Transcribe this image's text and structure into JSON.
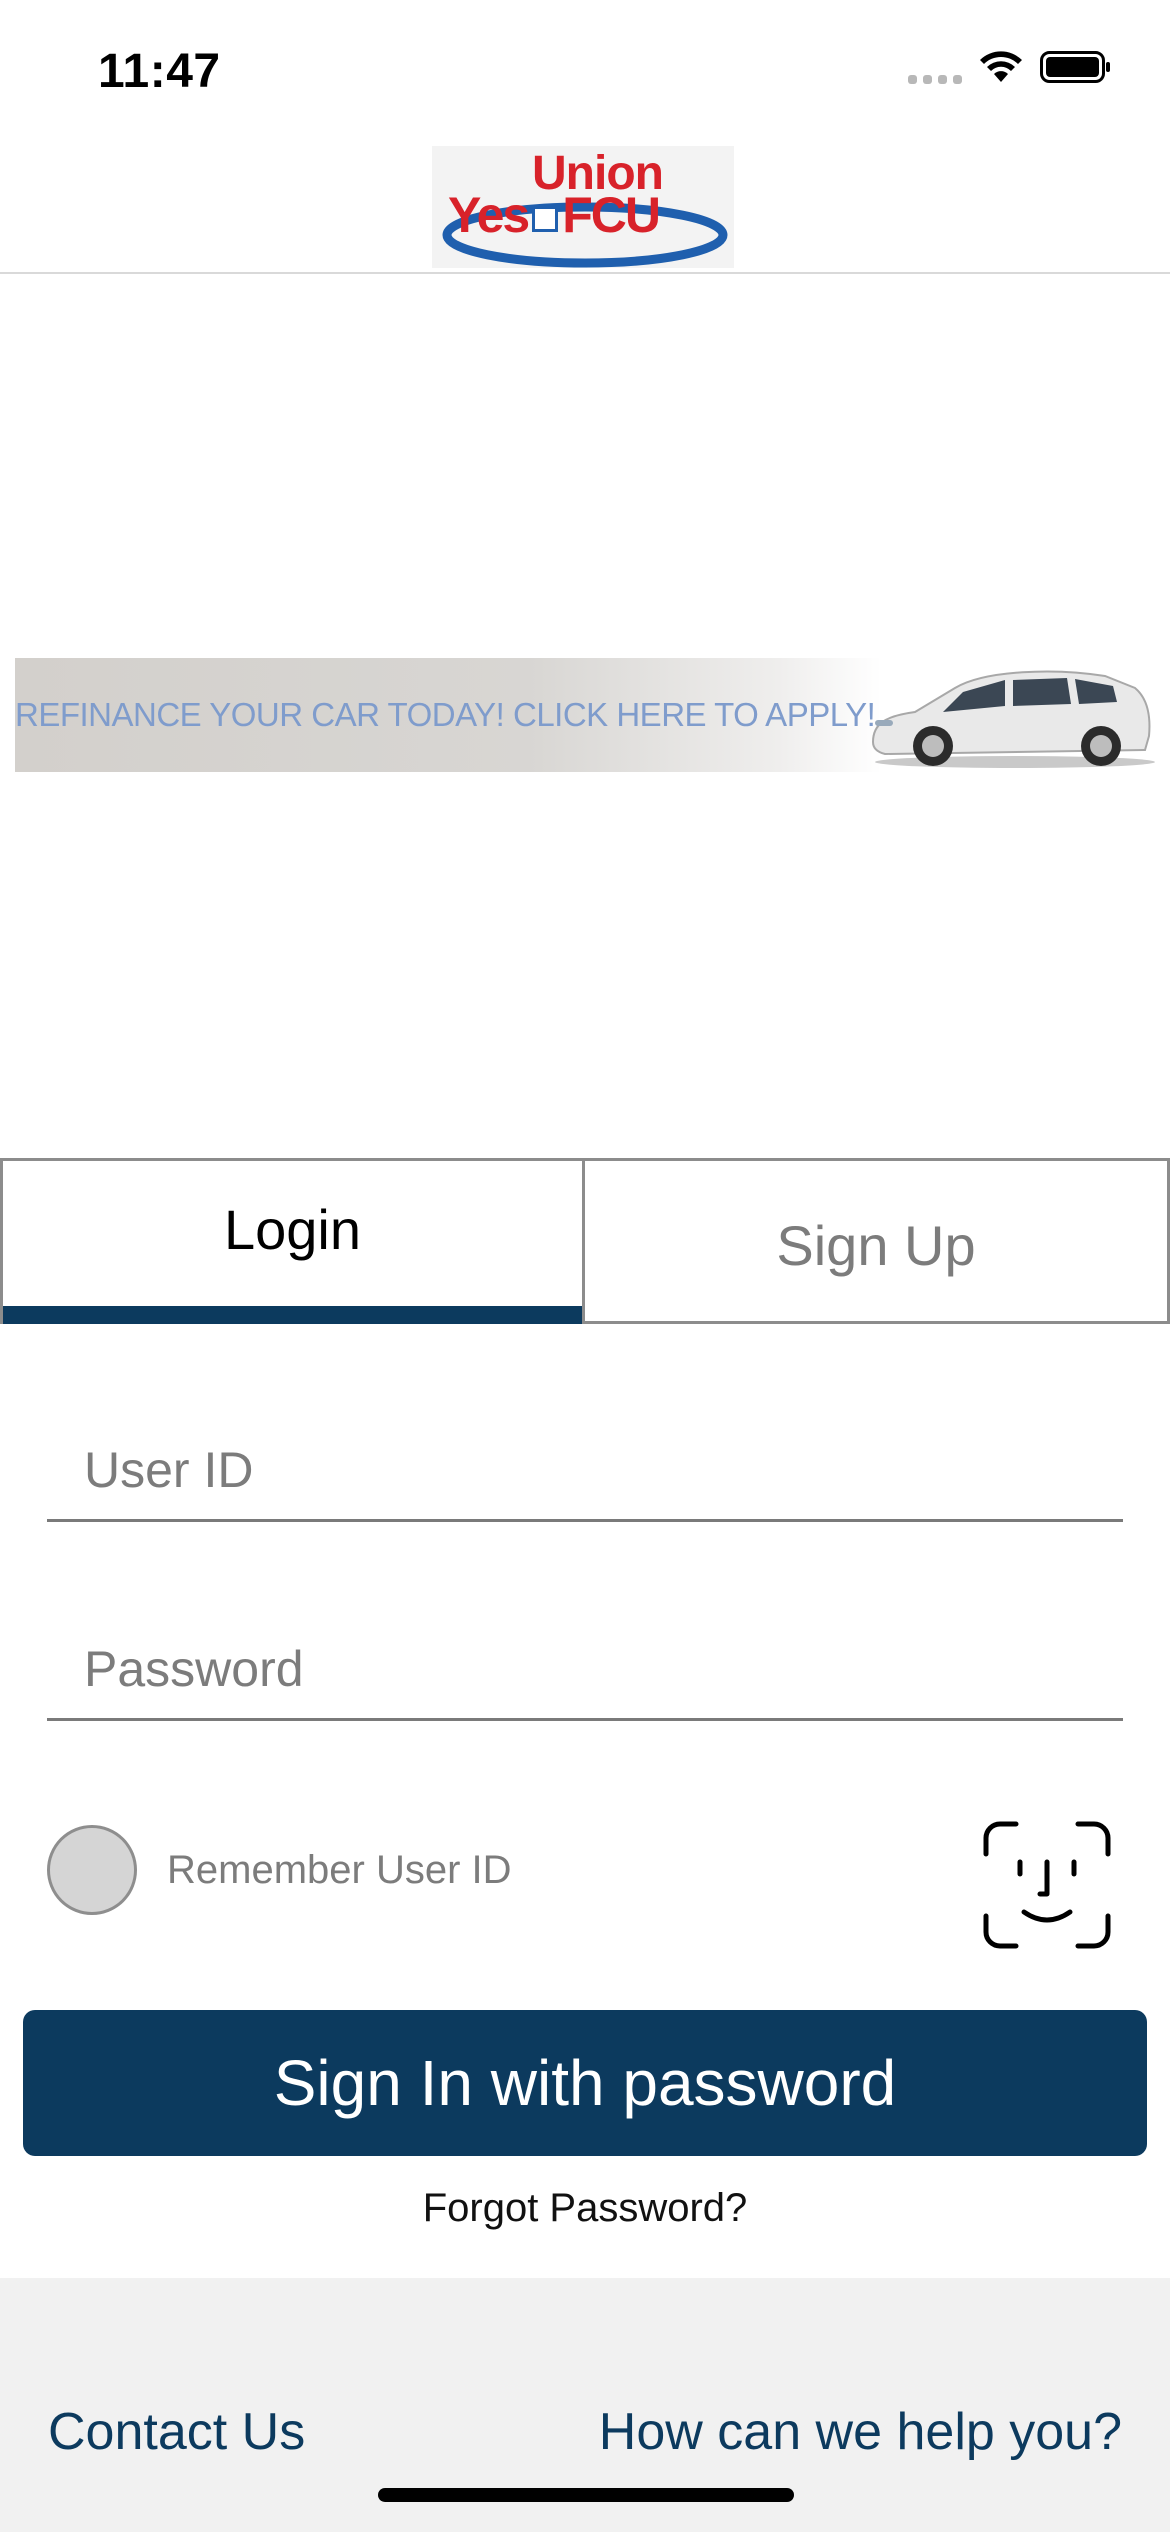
{
  "status_bar": {
    "time": "11:47",
    "icons": [
      "cellular-signal-icon",
      "wifi-icon",
      "battery-icon"
    ]
  },
  "header": {
    "logo": {
      "line1": "Union",
      "line2_left": "Yes",
      "line2_right": "FCU",
      "colors": {
        "text": "#d8222a",
        "swoosh": "#1f5fae"
      }
    }
  },
  "banner": {
    "text": "REFINANCE YOUR CAR TODAY! CLICK HERE TO APPLY!",
    "image": "car-image"
  },
  "tabs": [
    {
      "label": "Login",
      "selected": true
    },
    {
      "label": "Sign Up",
      "selected": false
    }
  ],
  "form": {
    "user_id": {
      "placeholder": "User ID",
      "value": ""
    },
    "password": {
      "placeholder": "Password",
      "value": ""
    },
    "remember_label": "Remember User ID",
    "remember_checked": false,
    "face_id_icon": "face-id-icon",
    "sign_in_label": "Sign In with password",
    "forgot_label": "Forgot Password?"
  },
  "footer": {
    "contact_label": "Contact Us",
    "help_label": "How can we help you?"
  },
  "colors": {
    "primary": "#0c3a5e",
    "tab_border": "#8c8c8c",
    "footer_bg": "#f1f1f1",
    "banner_text": "#7f9ccc"
  }
}
